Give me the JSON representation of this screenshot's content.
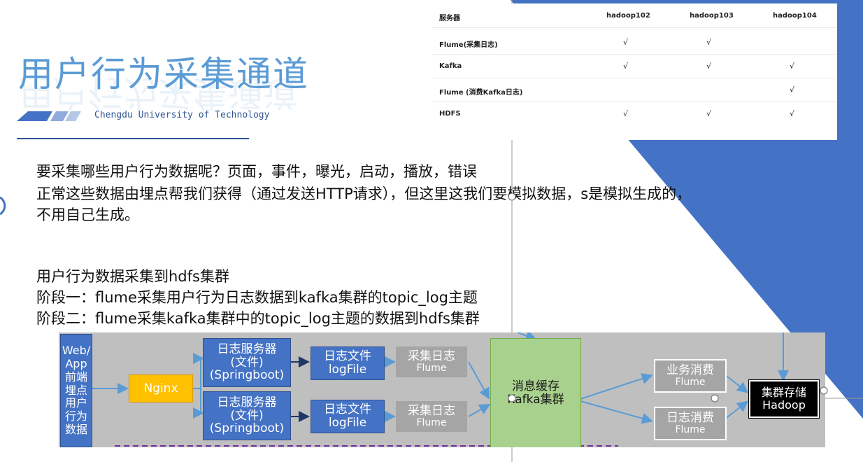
{
  "title": "用户行为采集通道",
  "subtitle": "Chengdu University of Technology",
  "paragraphs": [
    "要采集哪些用户行为数据呢？页面，事件，曝光，启动，播放，错误",
    "正常这些数据由埋点帮我们获得（通过发送HTTP请求），但这里这我们要模拟数据，s是模拟生成的，",
    "不用自己生成。",
    "用户行为数据采集到hdfs集群",
    "阶段一：flume采集用户行为日志数据到kafka集群的topic_log主题",
    "阶段二：flume采集kafka集群中的topic_log主题的数据到hdfs集群"
  ],
  "table": {
    "headers": [
      "服务器",
      "hadoop102",
      "hadoop103",
      "hadoop104"
    ],
    "rows": [
      {
        "name": "Flume(采集日志)",
        "cells": [
          "√",
          "√",
          ""
        ]
      },
      {
        "name": "Kafka",
        "cells": [
          "√",
          "√",
          "√"
        ]
      },
      {
        "name": "Flume (消费Kafka日志)",
        "cells": [
          "",
          "",
          "√"
        ]
      },
      {
        "name": "HDFS",
        "cells": [
          "√",
          "√",
          "√"
        ]
      }
    ]
  },
  "diagram": {
    "source": [
      "Web/",
      "App",
      "前端",
      "埋点",
      "用户",
      "行为",
      "数据"
    ],
    "nginx": "Nginx",
    "log_server_1": [
      "日志服务器",
      "(文件)",
      "(Springboot)"
    ],
    "log_server_2": [
      "日志服务器",
      "(文件)",
      "(Springboot)"
    ],
    "log_file_1": [
      "日志文件",
      "logFile"
    ],
    "log_file_2": [
      "日志文件",
      "logFile"
    ],
    "collect_1": [
      "采集日志",
      "Flume"
    ],
    "collect_2": [
      "采集日志",
      "Flume"
    ],
    "kafka": [
      "消息缓存",
      "Kafka集群"
    ],
    "business_consume": [
      "业务消费",
      "Flume"
    ],
    "log_consume": [
      "日志消费",
      "Flume"
    ],
    "hadoop": [
      "集群存储",
      "Hadoop"
    ]
  },
  "colors": {
    "title": "#5b9bd5",
    "accent_blue": "#4472c4",
    "nginx": "#ffc000",
    "kafka": "#a9d18e",
    "diagram_bg": "#bfbfbf"
  }
}
